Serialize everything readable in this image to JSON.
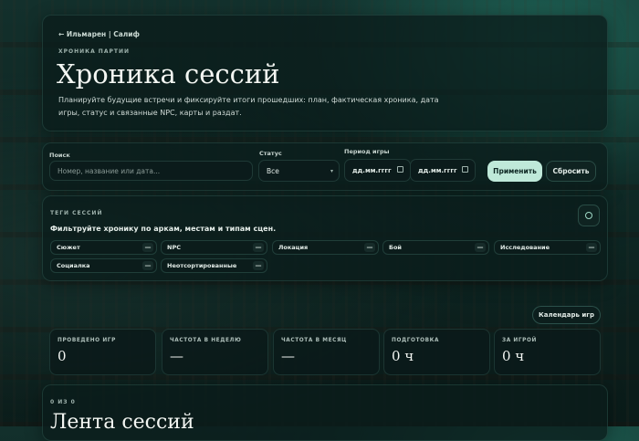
{
  "hero": {
    "back_link": "← Ильмарен | Салиф",
    "eyebrow": "ХРОНИКА ПАРТИИ",
    "title": "Хроника сессий",
    "lead": "Планируйте будущие встречи и фиксируйте итоги прошедших: план, фактическая хроника, дата игры, статус и связанные NPC, карты и раздат."
  },
  "filters": {
    "search_label": "Поиск",
    "search_placeholder": "Номер, название или дата...",
    "status_label": "Статус",
    "status_value": "Все",
    "period_label": "Период игры",
    "date_from": "дд.мм.гггг",
    "date_to": "дд.мм.гггг",
    "apply": "Применить",
    "reset": "Сбросить"
  },
  "tags": {
    "eyebrow": "ТЕГИ СЕССИЙ",
    "help": "Фильтруйте хронику по аркам, местам и типам сцен.",
    "items": [
      "Сюжет",
      "NPC",
      "Локация",
      "Бой",
      "Исследование",
      "Социалка",
      "Неотсортированные"
    ],
    "minus": "—"
  },
  "calendar_button": "Календарь игр",
  "stats": [
    {
      "label": "ПРОВЕДЕНО ИГР",
      "value": "0"
    },
    {
      "label": "ЧАСТОТА В НЕДЕЛЮ",
      "value": "—"
    },
    {
      "label": "ЧАСТОТА В МЕСЯЦ",
      "value": "—"
    },
    {
      "label": "ПОДГОТОВКА",
      "value": "0 ч"
    },
    {
      "label": "ЗА ИГРОЙ",
      "value": "0 ч"
    }
  ],
  "feed": {
    "count": "0 ИЗ 0",
    "title": "Лента сессий"
  }
}
